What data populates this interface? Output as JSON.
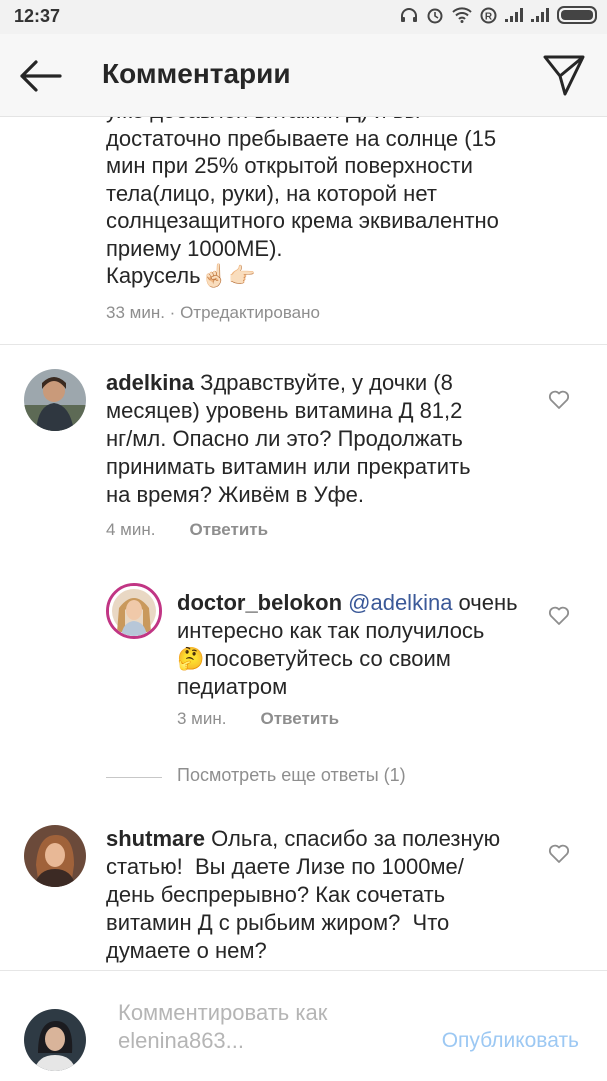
{
  "status_bar": {
    "time": "12:37",
    "icons": [
      "headphones-icon",
      "alarm-icon",
      "wifi-icon",
      "registered-icon",
      "signal-icon",
      "signal-icon",
      "battery-icon"
    ]
  },
  "header": {
    "title": "Комментарии",
    "back_icon": "back-arrow-icon",
    "send_icon": "send-icon"
  },
  "caption": {
    "text": "уже добавлен витамин Д) и вы\nдостаточно пребываете на солнце (15\nмин при 25% открытой поверхности\nтела(лицо, руки), на которой нет\nсолнцезащитного крема эквивалентно\nприему 1000МЕ).\nКарусель☝🏻👉🏻",
    "time": "33 мин.",
    "separator": "·",
    "edited": "Отредактировано"
  },
  "comments": [
    {
      "username": "adelkina",
      "text": " Здравствуйте, у дочки (8\nмесяцев) уровень витамина Д 81,2\nнг/мл. Опасно ли это? Продолжать\nпринимать витамин или прекратить\nна время? Живём в Уфе.",
      "time": "4 мин.",
      "reply_label": "Ответить"
    },
    {
      "username": "shutmare",
      "text": " Ольга, спасибо за полезную\nстатью!  Вы даете Лизе по 1000ме/\nдень беспрерывно? Как сочетать\nвитамин Д с рыбьим жиром?  Что\nдумаете о нем?"
    }
  ],
  "reply": {
    "username": "doctor_belokon",
    "mention": "@adelkina",
    "text": " очень\nинтересно как так получилось\n🤔посоветуйтесь со своим\nпедиатром",
    "time": "3 мин.",
    "reply_label": "Ответить"
  },
  "more_replies_label": "Посмотреть еще ответы (1)",
  "footer": {
    "placeholder": "Комментировать как\nelenina863...",
    "publish_label": "Опубликовать"
  },
  "colors": {
    "mention": "#3b5998",
    "publish": "#9cc8f3",
    "story_ring": "#c13584"
  }
}
